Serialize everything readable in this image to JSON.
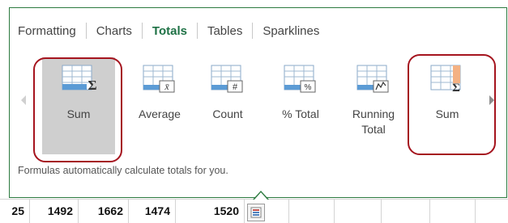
{
  "tabs": [
    {
      "label": "Formatting",
      "active": false
    },
    {
      "label": "Charts",
      "active": false
    },
    {
      "label": "Totals",
      "active": true
    },
    {
      "label": "Tables",
      "active": false
    },
    {
      "label": "Sparklines",
      "active": false
    }
  ],
  "tiles": [
    {
      "label": "Sum",
      "icon": "sum-row-icon",
      "selected": true
    },
    {
      "label": "Average",
      "icon": "average-icon",
      "selected": false
    },
    {
      "label": "Count",
      "icon": "count-icon",
      "selected": false
    },
    {
      "label": "% Total",
      "icon": "percent-total-icon",
      "selected": false
    },
    {
      "label": "Running\nTotal",
      "icon": "running-total-icon",
      "selected": false
    },
    {
      "label": "Sum",
      "icon": "sum-column-icon",
      "selected": false
    }
  ],
  "description": "Formulas automatically calculate totals for you.",
  "sheet_row": {
    "cells": [
      "25",
      "1492",
      "1662",
      "1474",
      "1520"
    ]
  },
  "colors": {
    "accent_green": "#1e7145",
    "panel_border": "#2b7a3f",
    "highlight_red": "#a5141e",
    "icon_blue": "#5b9bd5",
    "icon_orange": "#f4b183"
  }
}
